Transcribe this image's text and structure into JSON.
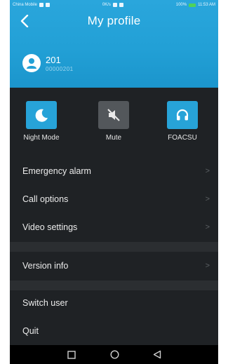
{
  "status_bar": {
    "left": "China Mobile",
    "middle": "0K/s",
    "battery": "100%",
    "time": "11:53 AM"
  },
  "header": {
    "title": "My profile",
    "back_icon": "back-chevron-icon"
  },
  "profile": {
    "name": "201",
    "sub": "00000201",
    "avatar_icon": "user-avatar-icon"
  },
  "modes": [
    {
      "label": "Night Mode",
      "icon": "moon-icon",
      "active": true
    },
    {
      "label": "Mute",
      "icon": "speaker-mute-icon",
      "active": false
    },
    {
      "label": "FOACSU",
      "icon": "headphones-icon",
      "active": true
    }
  ],
  "menu": {
    "emergency_alarm": "Emergency alarm",
    "call_options": "Call options",
    "video_settings": "Video settings",
    "version_info": "Version info",
    "switch_user": "Switch user",
    "quit": "Quit",
    "chevron": ">"
  },
  "colors": {
    "header_blue": "#22a0d6",
    "background": "#1f2225",
    "tile_blue": "#27a3d8",
    "tile_gray": "#53575b"
  },
  "system_nav": {
    "recents_icon": "square-icon",
    "home_icon": "circle-icon",
    "back_icon": "triangle-back-icon"
  }
}
